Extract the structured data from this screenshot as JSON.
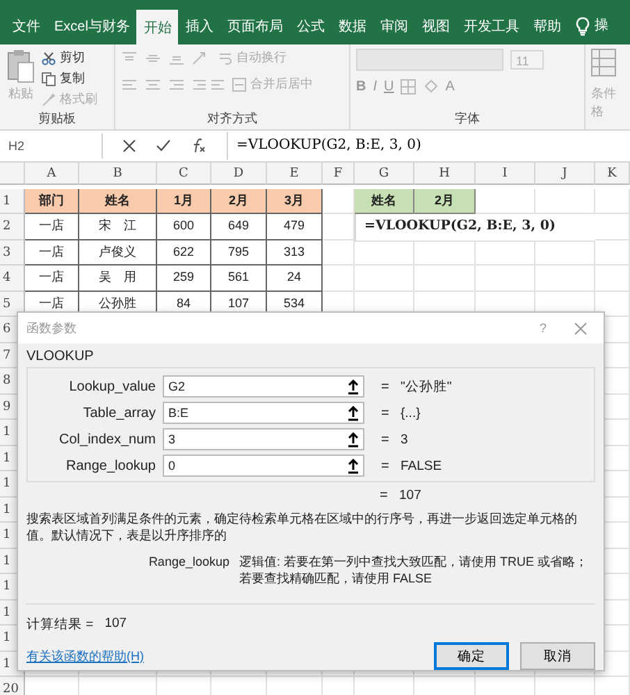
{
  "ribbon_tabs": [
    {
      "label": "文件",
      "selected": false
    },
    {
      "label": "Excel与财务",
      "selected": false
    },
    {
      "label": "开始",
      "selected": true
    },
    {
      "label": "插入",
      "selected": false
    },
    {
      "label": "页面布局",
      "selected": false
    },
    {
      "label": "公式",
      "selected": false
    },
    {
      "label": "数据",
      "selected": false
    },
    {
      "label": "审阅",
      "selected": false
    },
    {
      "label": "视图",
      "selected": false
    },
    {
      "label": "开发工具",
      "selected": false
    },
    {
      "label": "帮助",
      "selected": false
    }
  ],
  "tell_me": "操",
  "clipboard": {
    "paste": "粘贴",
    "cut": "剪切",
    "copy": "复制",
    "format_painter": "格式刷",
    "label": "剪贴板"
  },
  "alignment": {
    "wrap": "自动换行",
    "merge": "合并后居中",
    "label": "对齐方式"
  },
  "font": {
    "size": "11",
    "bold": "B",
    "italic": "I",
    "underline": "U",
    "color_letter": "A",
    "label": "字体"
  },
  "styles": {
    "conditional": "条件格"
  },
  "formula_bar": {
    "name_box": "H2",
    "formula": "=VLOOKUP(G2, B:E, 3, 0)"
  },
  "sheet": {
    "columns": [
      "A",
      "B",
      "C",
      "D",
      "E",
      "F",
      "G",
      "H",
      "I",
      "J",
      "K"
    ],
    "row_numbers": [
      "1",
      "2",
      "3",
      "4",
      "5",
      "6",
      "7",
      "8",
      "9",
      "1",
      "1",
      "1",
      "1",
      "1",
      "1",
      "1",
      "1",
      "1",
      "1",
      "20"
    ],
    "data_header": [
      "部门",
      "姓名",
      "1月",
      "2月",
      "3月"
    ],
    "data_rows": [
      [
        "一店",
        "宋　江",
        "600",
        "649",
        "479"
      ],
      [
        "一店",
        "卢俊义",
        "622",
        "795",
        "313"
      ],
      [
        "一店",
        "吴　用",
        "259",
        "561",
        "24"
      ],
      [
        "一店",
        "公孙胜",
        "84",
        "107",
        "534"
      ]
    ],
    "lookup_header": [
      "姓名",
      "2月"
    ],
    "lookup_formula": "=VLOOKUP(G2, B:E, 3, 0)"
  },
  "dialog": {
    "title": "函数参数",
    "help": "?",
    "function": "VLOOKUP",
    "arguments": [
      {
        "label": "Lookup_value",
        "value": "G2",
        "eq": "=",
        "result": "\"公孙胜\""
      },
      {
        "label": "Table_array",
        "value": "B:E",
        "eq": "=",
        "result": "{...}"
      },
      {
        "label": "Col_index_num",
        "value": "3",
        "eq": "=",
        "result": "3"
      },
      {
        "label": "Range_lookup",
        "value": "0",
        "eq": "=",
        "result": "FALSE"
      }
    ],
    "formula_eq": "=",
    "formula_result": "107",
    "description": "搜索表区域首列满足条件的元素，确定待检索单元格在区域中的行序号，再进一步返回选定单元格的值。默认情况下，表是以升序排序的",
    "arg_name": "Range_lookup",
    "arg_help": "逻辑值: 若要在第一列中查找大致匹配，请使用 TRUE 或省略；若要查找精确匹配，请使用 FALSE",
    "result_label": "计算结果 =",
    "result": "107",
    "help_link": "有关该函数的帮助(H)",
    "buttons": [
      {
        "label": "确定",
        "selected": true
      },
      {
        "label": "取消",
        "selected": false
      }
    ]
  }
}
